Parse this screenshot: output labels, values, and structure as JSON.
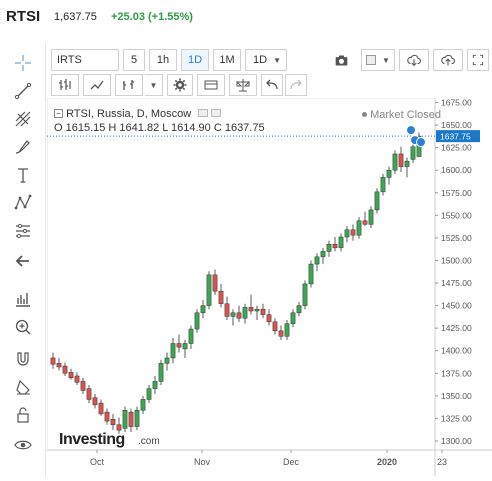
{
  "header": {
    "symbol": "RTSI",
    "price": "1,637.75",
    "change": "+25.03 (+1.55%)"
  },
  "toolbar": {
    "symbol_input": "IRTS",
    "intervals": [
      "5",
      "1h",
      "1D",
      "1M",
      "1D"
    ],
    "active_interval": "1D"
  },
  "legend": {
    "title": "RTSI, Russia, D, Moscow",
    "ohlc": "O 1615.15 H 1641.82 L 1614.90 C 1637.75",
    "status": "Market Closed"
  },
  "watermark": "Investing.com",
  "colors": {
    "up": "#3aa751",
    "down": "#d9534f",
    "accent": "#2a7fd4",
    "last_price": "#1a77c9"
  },
  "icons": {
    "left": [
      "crosshair-icon",
      "trendline-icon",
      "fib-icon",
      "brush-icon",
      "text-icon",
      "pattern-icon",
      "measure-icon",
      "back-arrow-icon",
      "chart-layout-icon",
      "zoom-icon",
      "magnet-icon",
      "eraser-icon",
      "lock-icon",
      "eye-icon"
    ],
    "toolbar": [
      "camera-icon",
      "square-icon",
      "cloud-down-icon",
      "cloud-up-icon",
      "bar-type-icon",
      "line-type-icon",
      "indicator-icon",
      "settings-icon",
      "balance-icon",
      "undo-icon",
      "redo-icon"
    ]
  },
  "chart_data": {
    "type": "candlestick",
    "y_ticks": [
      "1675.00",
      "1650.00",
      "1625.00",
      "1600.00",
      "1575.00",
      "1550.00",
      "1525.00",
      "1500.00",
      "1475.00",
      "1450.00",
      "1425.00",
      "1400.00",
      "1375.00",
      "1350.00",
      "1325.00",
      "1300.00"
    ],
    "x_ticks": [
      "Oct",
      "Nov",
      "Dec",
      "2020",
      "23"
    ],
    "ylim": [
      1290,
      1680
    ],
    "last_price_label": "1637.75",
    "candles": [
      [
        1392,
        1398,
        1380,
        1385
      ],
      [
        1386,
        1392,
        1378,
        1382
      ],
      [
        1383,
        1387,
        1372,
        1375
      ],
      [
        1376,
        1380,
        1368,
        1370
      ],
      [
        1372,
        1376,
        1362,
        1365
      ],
      [
        1366,
        1370,
        1352,
        1356
      ],
      [
        1358,
        1362,
        1342,
        1346
      ],
      [
        1348,
        1352,
        1336,
        1340
      ],
      [
        1342,
        1346,
        1328,
        1330
      ],
      [
        1332,
        1336,
        1318,
        1322
      ],
      [
        1324,
        1330,
        1312,
        1318
      ],
      [
        1318,
        1326,
        1308,
        1312
      ],
      [
        1314,
        1338,
        1310,
        1334
      ],
      [
        1332,
        1336,
        1310,
        1316
      ],
      [
        1316,
        1338,
        1312,
        1334
      ],
      [
        1334,
        1350,
        1330,
        1346
      ],
      [
        1346,
        1362,
        1342,
        1358
      ],
      [
        1358,
        1372,
        1352,
        1366
      ],
      [
        1366,
        1390,
        1362,
        1386
      ],
      [
        1386,
        1398,
        1378,
        1392
      ],
      [
        1392,
        1414,
        1386,
        1408
      ],
      [
        1408,
        1418,
        1398,
        1404
      ],
      [
        1402,
        1412,
        1392,
        1408
      ],
      [
        1408,
        1428,
        1402,
        1424
      ],
      [
        1424,
        1446,
        1420,
        1442
      ],
      [
        1442,
        1456,
        1436,
        1450
      ],
      [
        1450,
        1488,
        1446,
        1484
      ],
      [
        1484,
        1490,
        1462,
        1466
      ],
      [
        1466,
        1474,
        1448,
        1452
      ],
      [
        1452,
        1460,
        1434,
        1438
      ],
      [
        1438,
        1446,
        1428,
        1442
      ],
      [
        1442,
        1450,
        1432,
        1436
      ],
      [
        1436,
        1452,
        1430,
        1448
      ],
      [
        1448,
        1462,
        1440,
        1444
      ],
      [
        1444,
        1450,
        1434,
        1446
      ],
      [
        1446,
        1452,
        1436,
        1440
      ],
      [
        1440,
        1446,
        1428,
        1432
      ],
      [
        1432,
        1436,
        1418,
        1422
      ],
      [
        1422,
        1428,
        1412,
        1416
      ],
      [
        1416,
        1434,
        1412,
        1430
      ],
      [
        1430,
        1446,
        1426,
        1442
      ],
      [
        1442,
        1454,
        1438,
        1450
      ],
      [
        1450,
        1478,
        1446,
        1474
      ],
      [
        1474,
        1500,
        1470,
        1496
      ],
      [
        1496,
        1508,
        1488,
        1504
      ],
      [
        1504,
        1514,
        1496,
        1510
      ],
      [
        1510,
        1522,
        1504,
        1518
      ],
      [
        1518,
        1526,
        1510,
        1514
      ],
      [
        1514,
        1530,
        1510,
        1526
      ],
      [
        1526,
        1538,
        1520,
        1534
      ],
      [
        1534,
        1540,
        1522,
        1528
      ],
      [
        1528,
        1548,
        1524,
        1544
      ],
      [
        1544,
        1554,
        1538,
        1540
      ],
      [
        1540,
        1560,
        1536,
        1556
      ],
      [
        1556,
        1580,
        1552,
        1576
      ],
      [
        1576,
        1596,
        1572,
        1592
      ],
      [
        1592,
        1604,
        1584,
        1600
      ],
      [
        1600,
        1622,
        1596,
        1618
      ],
      [
        1618,
        1626,
        1598,
        1604
      ],
      [
        1604,
        1614,
        1592,
        1610
      ],
      [
        1612,
        1630,
        1608,
        1626
      ],
      [
        1615.15,
        1641.82,
        1614.9,
        1637.75
      ]
    ]
  }
}
